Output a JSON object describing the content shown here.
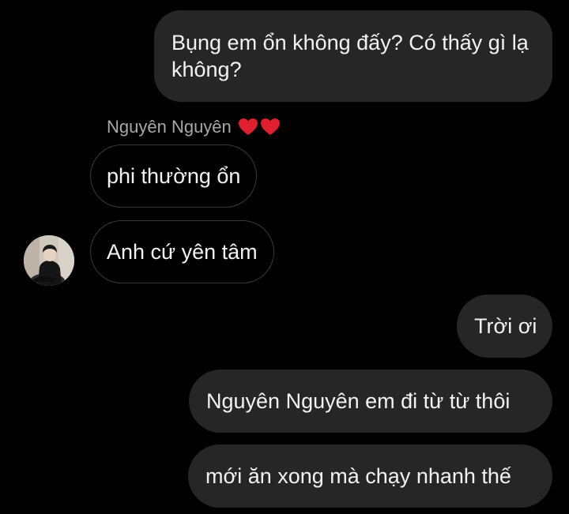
{
  "messages": {
    "m1": "Bụng em ổn không đấy? Có thấy gì lạ không?",
    "m2": "phi thường ổn",
    "m3": "Anh cứ yên tâm",
    "m4": "Trời ơi",
    "m5": "Nguyên Nguyên em đi từ từ thôi",
    "m6": "mới ăn xong mà chạy nhanh thế"
  },
  "sender": {
    "name": "Nguyên Nguyên",
    "emoji": "heart-icon"
  },
  "colors": {
    "background": "#000000",
    "outgoing_bubble": "#262626",
    "incoming_border": "#3a3a3a",
    "text": "#f2f2f2",
    "sender_text": "#a8a8a8",
    "heart": "#e0202e"
  }
}
